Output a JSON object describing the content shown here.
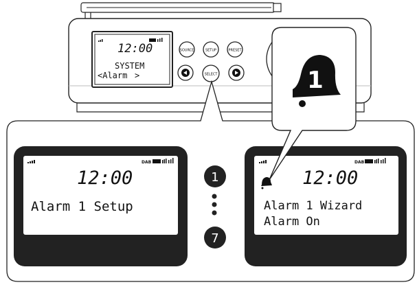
{
  "radio": {
    "screen": {
      "time": "12:00",
      "line1": "SYSTEM",
      "line2_left": "<Alarm",
      "line2_right": ">"
    },
    "buttons": {
      "source": "SOURCE",
      "setup": "SETUP",
      "preset": "PRESET",
      "select": "SELECT"
    }
  },
  "callout": {
    "alarm_number": "1"
  },
  "left_display": {
    "time": "12:00",
    "band": "DAB",
    "text": "Alarm 1 Setup"
  },
  "steps": {
    "first": "1",
    "last": "7"
  },
  "right_display": {
    "time": "12:00",
    "band": "DAB",
    "line1": "Alarm 1 Wizard",
    "line2": "Alarm On"
  }
}
